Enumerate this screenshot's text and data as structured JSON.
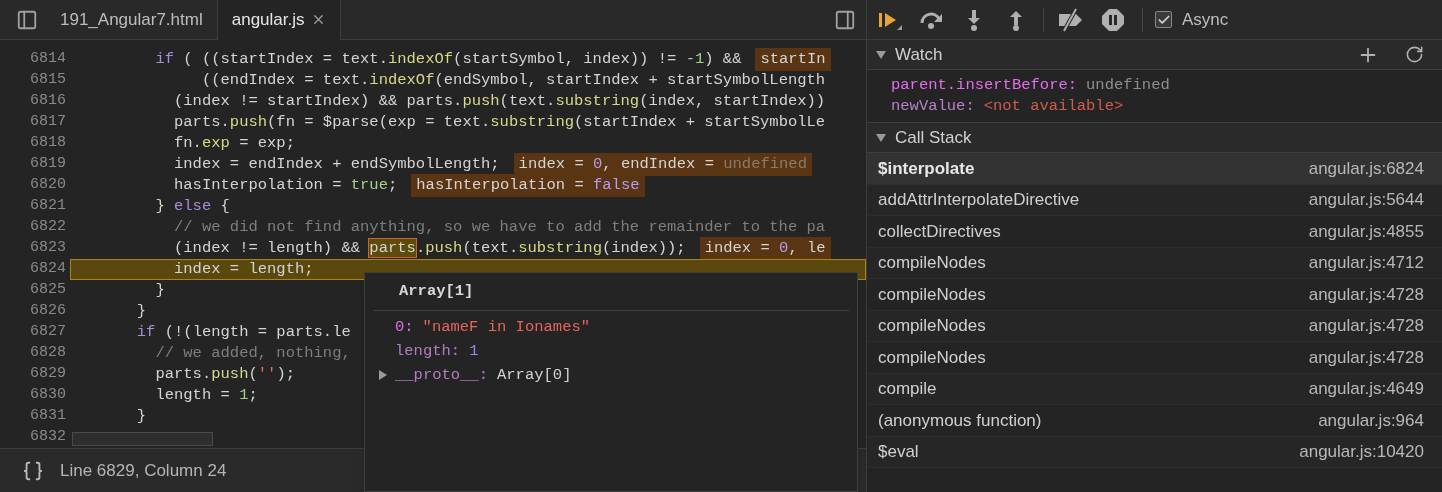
{
  "tabs": [
    {
      "label": "191_Angular7.html",
      "selected": false,
      "closable": false
    },
    {
      "label": "angular.js",
      "selected": true,
      "closable": true
    }
  ],
  "code": {
    "lines": [
      {
        "number": "6814",
        "current": false,
        "segments": [
          {
            "kind": "kw",
            "text": "        if"
          },
          {
            "kind": "plain",
            "text": " ( ((startIndex = text."
          },
          {
            "kind": "fn",
            "text": "indexOf"
          },
          {
            "kind": "plain",
            "text": "(startSymbol, index)) != "
          },
          {
            "kind": "num",
            "text": "-1"
          },
          {
            "kind": "plain",
            "text": ") &&"
          }
        ],
        "inline_value": [
          {
            "kind": "plain",
            "text": "startIn"
          }
        ]
      },
      {
        "number": "6815",
        "current": false,
        "segments": [
          {
            "kind": "plain",
            "text": "             ((endIndex = text."
          },
          {
            "kind": "fn",
            "text": "indexOf"
          },
          {
            "kind": "plain",
            "text": "(endSymbol, startIndex + startSymbolLength"
          }
        ]
      },
      {
        "number": "6816",
        "current": false,
        "segments": [
          {
            "kind": "plain",
            "text": "          (index != startIndex) && parts."
          },
          {
            "kind": "fn",
            "text": "push"
          },
          {
            "kind": "plain",
            "text": "(text."
          },
          {
            "kind": "fn",
            "text": "substring"
          },
          {
            "kind": "plain",
            "text": "(index, startIndex))"
          }
        ]
      },
      {
        "number": "6817",
        "current": false,
        "segments": [
          {
            "kind": "plain",
            "text": "          parts."
          },
          {
            "kind": "fn",
            "text": "push"
          },
          {
            "kind": "plain",
            "text": "(fn = $parse(exp = text."
          },
          {
            "kind": "fn",
            "text": "substring"
          },
          {
            "kind": "plain",
            "text": "(startIndex + startSymbolLe"
          }
        ]
      },
      {
        "number": "6818",
        "current": false,
        "segments": [
          {
            "kind": "plain",
            "text": "          fn."
          },
          {
            "kind": "fn",
            "text": "exp"
          },
          {
            "kind": "plain",
            "text": " = exp;"
          }
        ]
      },
      {
        "number": "6819",
        "current": false,
        "segments": [
          {
            "kind": "plain",
            "text": "          index = endIndex + endSymbolLength;"
          }
        ],
        "inline_value": [
          {
            "kind": "plain",
            "text": "index = "
          },
          {
            "kind": "value",
            "text": "0"
          },
          {
            "kind": "plain",
            "text": ", endIndex = "
          },
          {
            "kind": "undef",
            "text": "undefined"
          }
        ]
      },
      {
        "number": "6820",
        "current": false,
        "segments": [
          {
            "kind": "plain",
            "text": "          hasInterpolation = "
          },
          {
            "kind": "num",
            "text": "true"
          },
          {
            "kind": "plain",
            "text": ";"
          }
        ],
        "inline_value": [
          {
            "kind": "plain",
            "text": "hasInterpolation = "
          },
          {
            "kind": "value",
            "text": "false"
          }
        ]
      },
      {
        "number": "6821",
        "current": false,
        "segments": [
          {
            "kind": "plain",
            "text": "        } "
          },
          {
            "kind": "kw",
            "text": "else"
          },
          {
            "kind": "plain",
            "text": " {"
          }
        ]
      },
      {
        "number": "6822",
        "current": false,
        "segments": [
          {
            "kind": "comment",
            "text": "          // we did not find anything, so we have to add the remainder to the pa"
          }
        ]
      },
      {
        "number": "6823",
        "current": false,
        "segments": [
          {
            "kind": "plain",
            "text": "          (index != length) && "
          },
          {
            "kind": "hover",
            "text": "parts"
          },
          {
            "kind": "plain",
            "text": "."
          },
          {
            "kind": "fn",
            "text": "push"
          },
          {
            "kind": "plain",
            "text": "(text."
          },
          {
            "kind": "fn",
            "text": "substring"
          },
          {
            "kind": "plain",
            "text": "(index));"
          }
        ],
        "inline_value": [
          {
            "kind": "plain",
            "text": "index = "
          },
          {
            "kind": "value",
            "text": "0"
          },
          {
            "kind": "plain",
            "text": ", le"
          }
        ]
      },
      {
        "number": "6824",
        "current": true,
        "segments": [
          {
            "kind": "plain",
            "text": "          index = length;"
          }
        ]
      },
      {
        "number": "6825",
        "current": false,
        "segments": [
          {
            "kind": "plain",
            "text": "        }"
          }
        ]
      },
      {
        "number": "6826",
        "current": false,
        "segments": [
          {
            "kind": "plain",
            "text": "      }"
          }
        ]
      },
      {
        "number": "6827",
        "current": false,
        "segments": [
          {
            "kind": "kw",
            "text": "      if"
          },
          {
            "kind": "plain",
            "text": " (!(length = parts.le"
          }
        ]
      },
      {
        "number": "6828",
        "current": false,
        "segments": [
          {
            "kind": "comment",
            "text": "        // we added, nothing,"
          }
        ]
      },
      {
        "number": "6829",
        "current": false,
        "segments": [
          {
            "kind": "plain",
            "text": "        parts."
          },
          {
            "kind": "fn",
            "text": "push"
          },
          {
            "kind": "plain",
            "text": "("
          },
          {
            "kind": "str",
            "text": "''"
          },
          {
            "kind": "plain",
            "text": ");"
          }
        ]
      },
      {
        "number": "6830",
        "current": false,
        "segments": [
          {
            "kind": "plain",
            "text": "        length = "
          },
          {
            "kind": "num",
            "text": "1"
          },
          {
            "kind": "plain",
            "text": ";"
          }
        ]
      },
      {
        "number": "6831",
        "current": false,
        "segments": [
          {
            "kind": "plain",
            "text": "      }"
          }
        ]
      },
      {
        "number": "6832",
        "current": false
      }
    ]
  },
  "hover_popover": {
    "title": "Array[1]",
    "properties": [
      {
        "key": "0:",
        "value": "\"nameF in Ionames\"",
        "kind": "string",
        "enumerable": true
      },
      {
        "key": "length:",
        "value": "1",
        "kind": "number",
        "enumerable": false
      },
      {
        "key": "__proto__:",
        "value": "Array[0]",
        "kind": "object",
        "enumerable": false
      }
    ]
  },
  "status_bar": {
    "position": "Line 6829, Column 24"
  },
  "debugger_toolbar": {
    "async": {
      "label": "Async",
      "checked": true
    }
  },
  "watch": {
    "title": "Watch",
    "expanded": true,
    "expressions": [
      {
        "name": "parent.insertBefore:",
        "value": "undefined",
        "kind": "undefined"
      },
      {
        "name": "newValue:",
        "value": "<not available>",
        "kind": "error"
      }
    ]
  },
  "call_stack": {
    "title": "Call Stack",
    "expanded": true,
    "frames": [
      {
        "name": "$interpolate",
        "location": "angular.js:6824",
        "selected": true
      },
      {
        "name": "addAttrInterpolateDirective",
        "location": "angular.js:5644",
        "selected": false
      },
      {
        "name": "collectDirectives",
        "location": "angular.js:4855",
        "selected": false
      },
      {
        "name": "compileNodes",
        "location": "angular.js:4712",
        "selected": false
      },
      {
        "name": "compileNodes",
        "location": "angular.js:4728",
        "selected": false
      },
      {
        "name": "compileNodes",
        "location": "angular.js:4728",
        "selected": false
      },
      {
        "name": "compileNodes",
        "location": "angular.js:4728",
        "selected": false
      },
      {
        "name": "compile",
        "location": "angular.js:4649",
        "selected": false
      },
      {
        "name": "(anonymous function)",
        "location": "angular.js:964",
        "selected": false
      },
      {
        "name": "$eval",
        "location": "angular.js:10420",
        "selected": false
      }
    ]
  }
}
